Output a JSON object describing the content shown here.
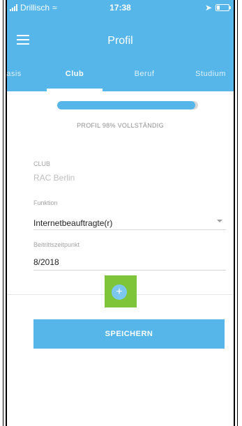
{
  "statusbar": {
    "carrier": "Drillisch",
    "time": "17:38"
  },
  "header": {
    "title": "Profil",
    "tabs": [
      {
        "label": "asis"
      },
      {
        "label": "Club"
      },
      {
        "label": "Beruf"
      },
      {
        "label": "Studium"
      }
    ],
    "active_tab": "Club"
  },
  "profile": {
    "progress_percent": 98,
    "progress_text": "PROFIL 98% VOLLSTÄNDIG"
  },
  "form": {
    "club_label": "CLUB",
    "club_value": "RAC Berlin",
    "funktion_label": "Funktion",
    "funktion_value": "Internetbeauftragte(r)",
    "beitritt_label": "Beitrittszeitpunkt",
    "beitritt_value": "8/2018",
    "add_symbol": "+",
    "save_label": "SPEICHERN"
  },
  "colors": {
    "primary": "#56b6e9",
    "highlight": "#7ec53a"
  }
}
